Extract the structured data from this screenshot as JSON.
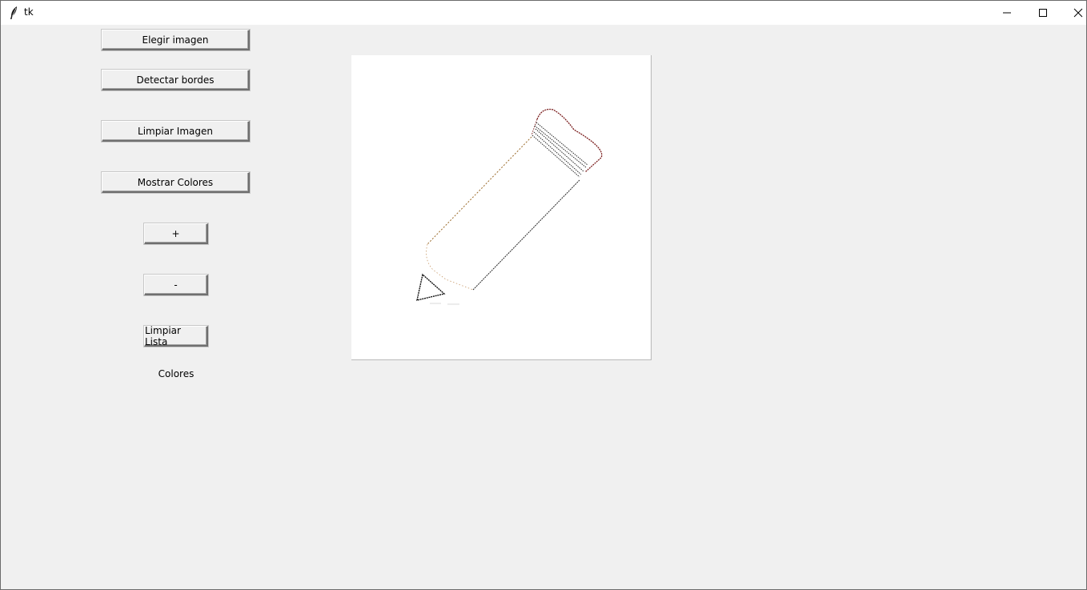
{
  "window": {
    "title": "tk",
    "icon": "tk-feather-icon",
    "controls": [
      "minimize-icon",
      "maximize-icon",
      "close-icon"
    ]
  },
  "buttons": {
    "choose_image": "Elegir imagen",
    "detect_edges": "Detectar bordes",
    "clear_image": "Limpiar Imagen",
    "show_colors": "Mostrar Colores",
    "zoom_in": "+",
    "zoom_out": "-",
    "clear_list": "Limpiar Lista"
  },
  "labels": {
    "colors": "Colores"
  },
  "image": {
    "content": "pencil-edge-detection-image"
  }
}
